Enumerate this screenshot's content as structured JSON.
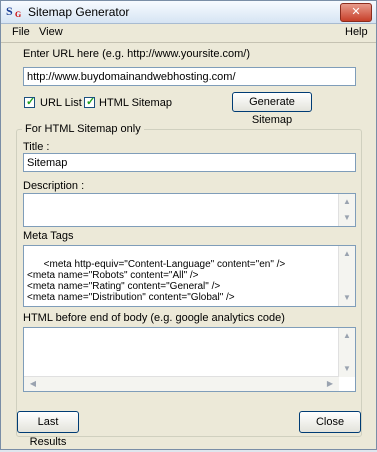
{
  "window": {
    "title": "Sitemap Generator",
    "icon_letter": "S",
    "icon_sub": "G",
    "close_glyph": "✕"
  },
  "menu": {
    "file": "File",
    "view": "View",
    "help": "Help"
  },
  "url": {
    "label": "Enter URL here (e.g. http://www.yoursite.com/)",
    "value": "http://www.buydomainandwebhosting.com/"
  },
  "options": {
    "url_list_label": "URL List",
    "url_list_checked": true,
    "html_sitemap_label": "HTML Sitemap",
    "html_sitemap_checked": true,
    "generate_button": "Generate Sitemap"
  },
  "html_sitemap": {
    "group_title": "For HTML Sitemap only",
    "title_label": "Title :",
    "title_value": "Sitemap",
    "description_label": "Description :",
    "description_value": "",
    "meta_label": "Meta Tags",
    "meta_value": "<meta http-equiv=\"Content-Language\" content=\"en\" />\n<meta name=\"Robots\" content=\"All\" />\n<meta name=\"Rating\" content=\"General\" />\n<meta name=\"Distribution\" content=\"Global\" />",
    "body_label": "HTML before end of body (e.g. google analytics code)",
    "body_value": ""
  },
  "footer": {
    "last_results": "Last Results",
    "close": "Close"
  },
  "icons": {
    "up": "▲",
    "down": "▼",
    "left": "◀",
    "right": "▶",
    "check": "✓"
  }
}
